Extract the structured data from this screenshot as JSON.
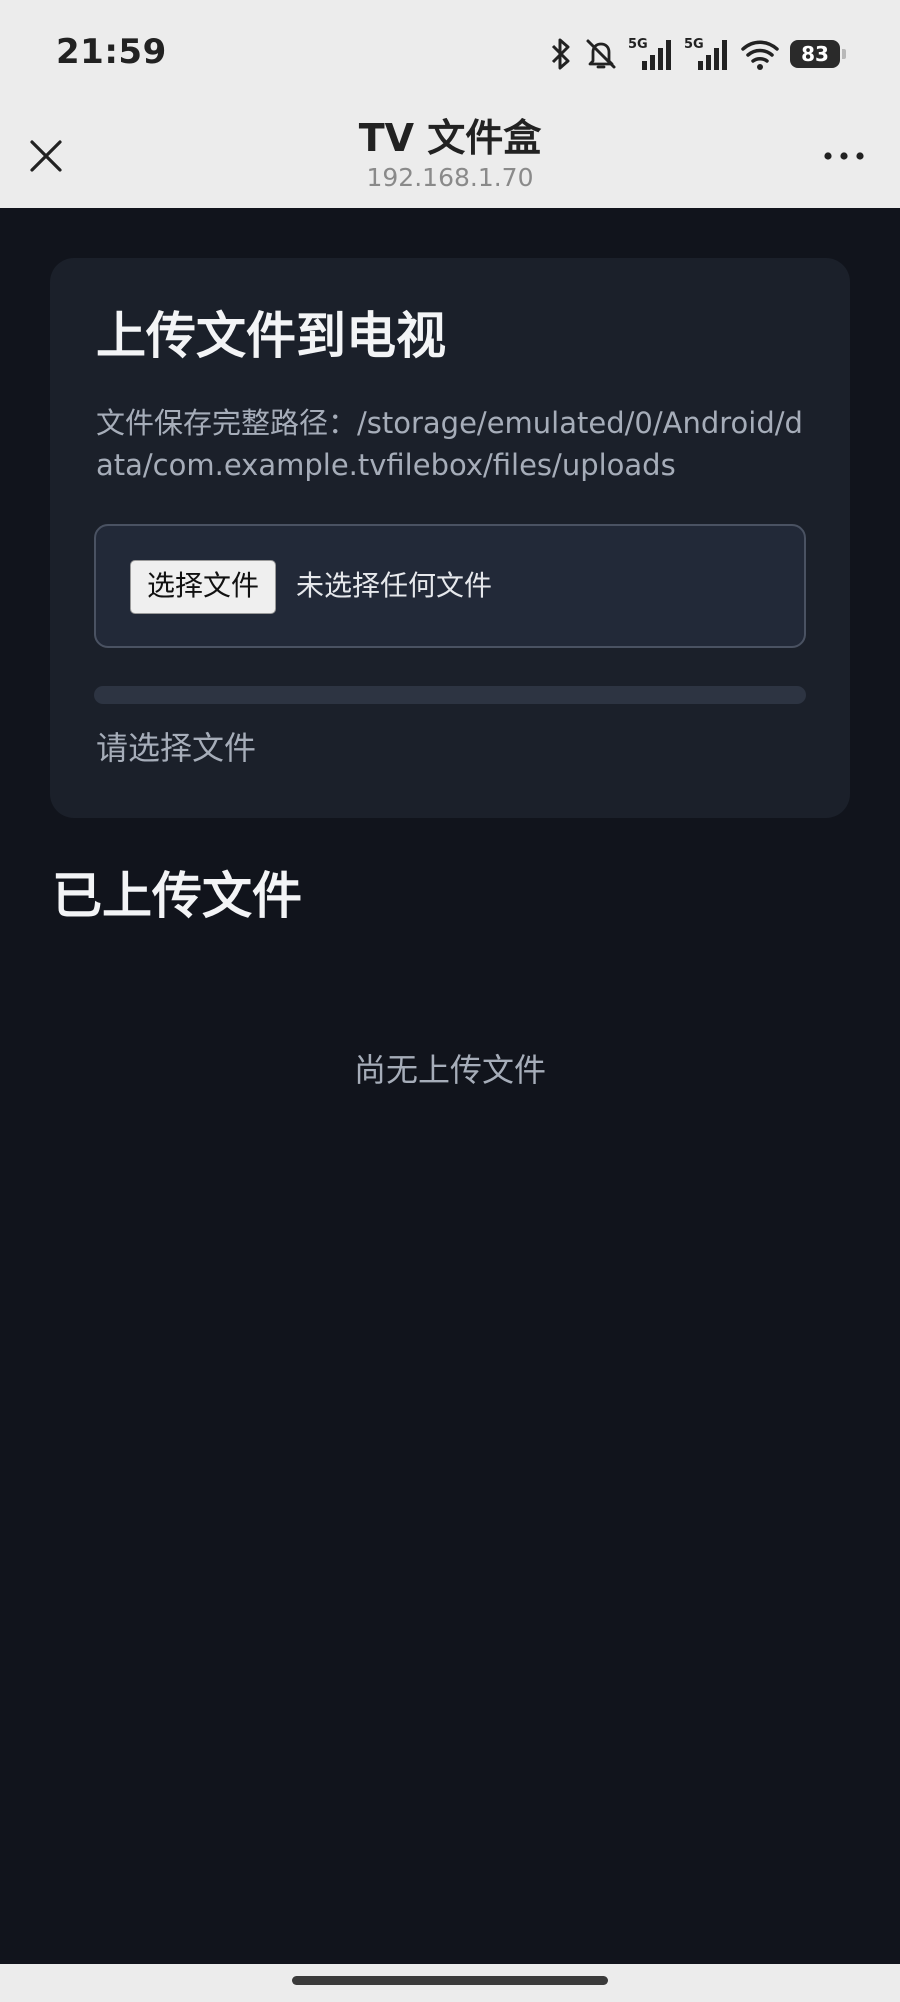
{
  "status_bar": {
    "time": "21:59",
    "network_1": "5G",
    "network_2": "5G",
    "battery": "83",
    "icons": [
      "bluetooth-icon",
      "mute-bell-icon",
      "signal-5g-icon",
      "signal-5g-icon",
      "wifi-icon",
      "battery-icon"
    ]
  },
  "title_bar": {
    "title": "TV 文件盒",
    "subtitle": "192.168.1.70",
    "close_icon": "close-icon",
    "more_icon": "more-horizontal-icon"
  },
  "upload_card": {
    "title": "上传文件到电视",
    "path": "文件保存完整路径：/storage/emulated/0/Android/data/com.example.tvfilebox/files/uploads",
    "choose_button": "选择文件",
    "no_file": "未选择任何文件",
    "progress": 0,
    "status": "请选择文件"
  },
  "uploaded_section": {
    "title": "已上传文件",
    "empty_text": "尚无上传文件"
  },
  "colors": {
    "page_bg": "#11141c",
    "card_bg": "#1b202a",
    "chrome_bg": "#ececec",
    "progress_accent": "#3b82f6"
  }
}
